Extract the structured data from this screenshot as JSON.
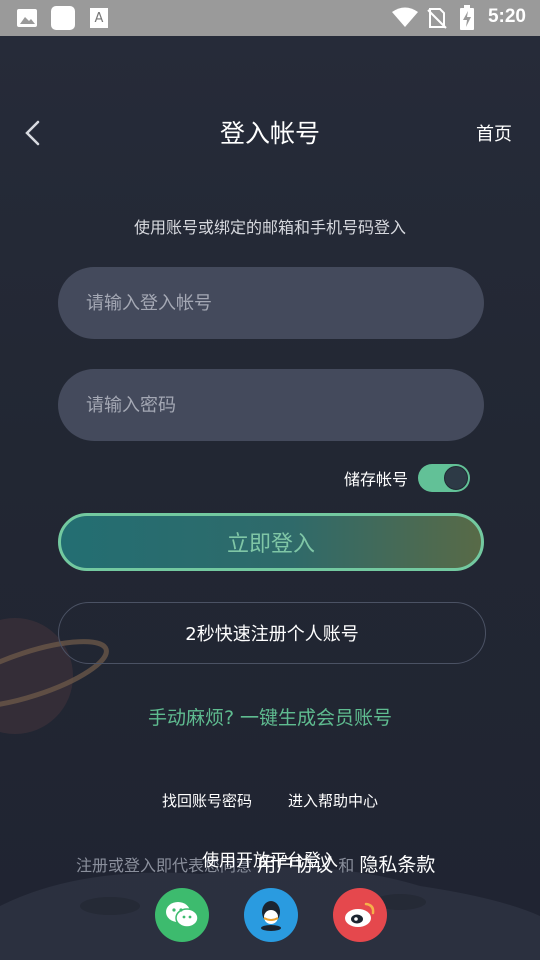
{
  "status_bar": {
    "time": "5:20",
    "icons": [
      "gallery-icon",
      "app-square-icon",
      "font-icon",
      "wifi-icon",
      "no-sim-icon",
      "battery-charging-icon"
    ]
  },
  "header": {
    "title": "登入帐号",
    "home_label": "首页"
  },
  "subtitle": "使用账号或绑定的邮箱和手机号码登入",
  "form": {
    "account_placeholder": "请输入登入帐号",
    "password_placeholder": "请输入密码",
    "account_value": "",
    "password_value": "",
    "save_label": "储存帐号",
    "save_enabled": true
  },
  "buttons": {
    "login": "立即登入",
    "register": "2秒快速注册个人账号"
  },
  "oneclick_link": "手动麻烦? 一键生成会员账号",
  "links": {
    "recover": "找回账号密码",
    "help": "进入帮助中心"
  },
  "open_platform_label": "使用开放平台登入",
  "agreement": {
    "prefix": "注册或登入即代表您同意",
    "user_agreement": "用户协议",
    "and": "和",
    "privacy": "隐私条款"
  },
  "social": [
    {
      "name": "wechat",
      "color": "#3dbb6e"
    },
    {
      "name": "qq",
      "color": "#2a9be0"
    },
    {
      "name": "weibo",
      "color": "#e5484d"
    }
  ],
  "colors": {
    "accent": "#62c197",
    "link": "#5fbc90",
    "background": "#222733",
    "input_bg": "#444a5c"
  }
}
